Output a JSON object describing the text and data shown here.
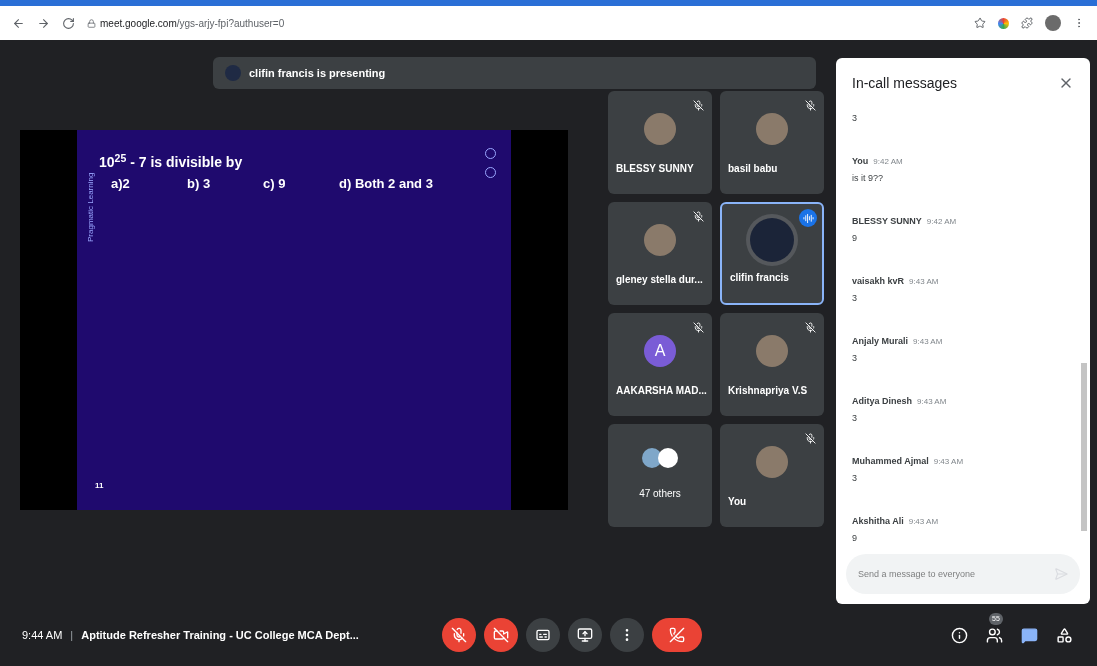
{
  "browser": {
    "url_host": "meet.google.com",
    "url_path": "/ygs-arjy-fpi?authuser=0"
  },
  "presenting_banner": {
    "text": "clifin francis is presenting"
  },
  "slide": {
    "side_text": "Pragmatic Learning",
    "question": "10$^{25}$ - 7 is divisible by",
    "options": [
      "a)2",
      "b) 3",
      "c) 9",
      "d) Both 2 and 3"
    ],
    "page": "11"
  },
  "tiles": [
    {
      "name": "BLESSY SUNNY",
      "kind": "photo",
      "muted": true,
      "speaking": false,
      "selected": false
    },
    {
      "name": "basil babu",
      "kind": "photo",
      "muted": true,
      "speaking": false,
      "selected": false
    },
    {
      "name": "gleney stella dur...",
      "kind": "photo",
      "muted": true,
      "speaking": false,
      "selected": false
    },
    {
      "name": "clifin francis",
      "kind": "photo",
      "muted": false,
      "speaking": true,
      "selected": true
    },
    {
      "name": "AAKARSHA MAD...",
      "kind": "letter",
      "letter": "A",
      "color": "#7a5cd6",
      "muted": true,
      "speaking": false,
      "selected": false
    },
    {
      "name": "Krishnapriya V.S",
      "kind": "photo",
      "muted": true,
      "speaking": false,
      "selected": false
    },
    {
      "name": "47 others",
      "kind": "group",
      "muted": false,
      "speaking": false,
      "selected": false
    },
    {
      "name": "You",
      "kind": "photo",
      "muted": true,
      "speaking": false,
      "selected": false
    }
  ],
  "chat": {
    "title": "In-call messages",
    "messages": [
      {
        "text": "3"
      },
      {
        "sender": "You",
        "time": "9:42 AM",
        "text": "is it 9??"
      },
      {
        "sender": "BLESSY SUNNY",
        "time": "9:42 AM",
        "text": "9"
      },
      {
        "sender": "vaisakh kvR",
        "time": "9:43 AM",
        "text": "3"
      },
      {
        "sender": "Anjaly Murali",
        "time": "9:43 AM",
        "text": "3"
      },
      {
        "sender": "Aditya Dinesh",
        "time": "9:43 AM",
        "text": "3"
      },
      {
        "sender": "Muhammed Ajmal",
        "time": "9:43 AM",
        "text": "3"
      },
      {
        "sender": "Akshitha Ali",
        "time": "9:43 AM",
        "text": "9"
      }
    ],
    "input_placeholder": "Send a message to everyone"
  },
  "bottom_bar": {
    "time": "9:44 AM",
    "separator": "|",
    "meeting_title": "Aptitude Refresher Training - UC College MCA Dept...",
    "controls": [
      {
        "kind": "mic",
        "off": true
      },
      {
        "kind": "camera",
        "off": true
      },
      {
        "kind": "captions",
        "off": false
      },
      {
        "kind": "present",
        "off": false
      },
      {
        "kind": "more",
        "off": false
      },
      {
        "kind": "end"
      }
    ],
    "right": [
      {
        "kind": "info",
        "selected": false
      },
      {
        "kind": "people",
        "badge": "55",
        "selected": false
      },
      {
        "kind": "chat",
        "selected": true
      },
      {
        "kind": "activities",
        "selected": false
      }
    ]
  }
}
